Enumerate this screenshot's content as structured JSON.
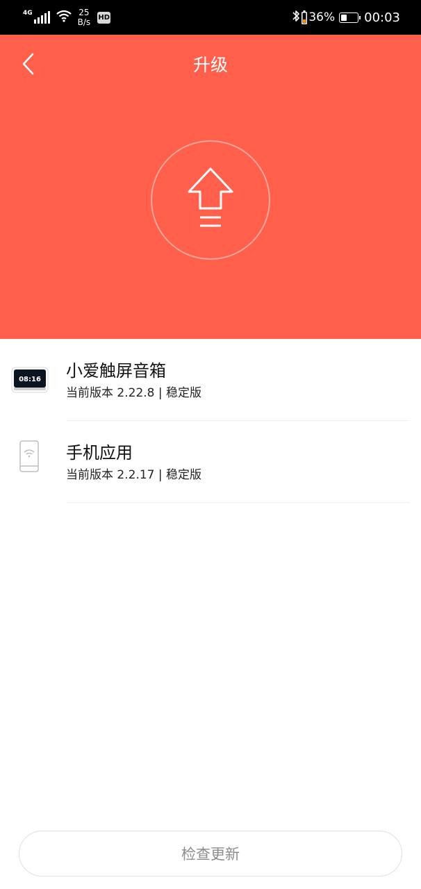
{
  "status_bar": {
    "network_type": "4G",
    "speed_value": "25",
    "speed_unit": "B/s",
    "hd_label": "HD",
    "battery_percent": "36%",
    "battery_level": 0.36,
    "time": "00:03"
  },
  "header": {
    "title": "升级",
    "background_color": "#ff5f4b",
    "icons": [
      "back-arrow-icon",
      "upgrade-arrow-icon"
    ]
  },
  "devices": [
    {
      "name": "小爱触屏音箱",
      "version_line": "当前版本 2.22.8 | 稳定版",
      "icon": "touchscreen-speaker-icon",
      "screen_time": "08:16"
    },
    {
      "name": "手机应用",
      "version_line": "当前版本 2.2.17 | 稳定版",
      "icon": "phone-app-icon"
    }
  ],
  "actions": {
    "check_update_label": "检查更新"
  }
}
